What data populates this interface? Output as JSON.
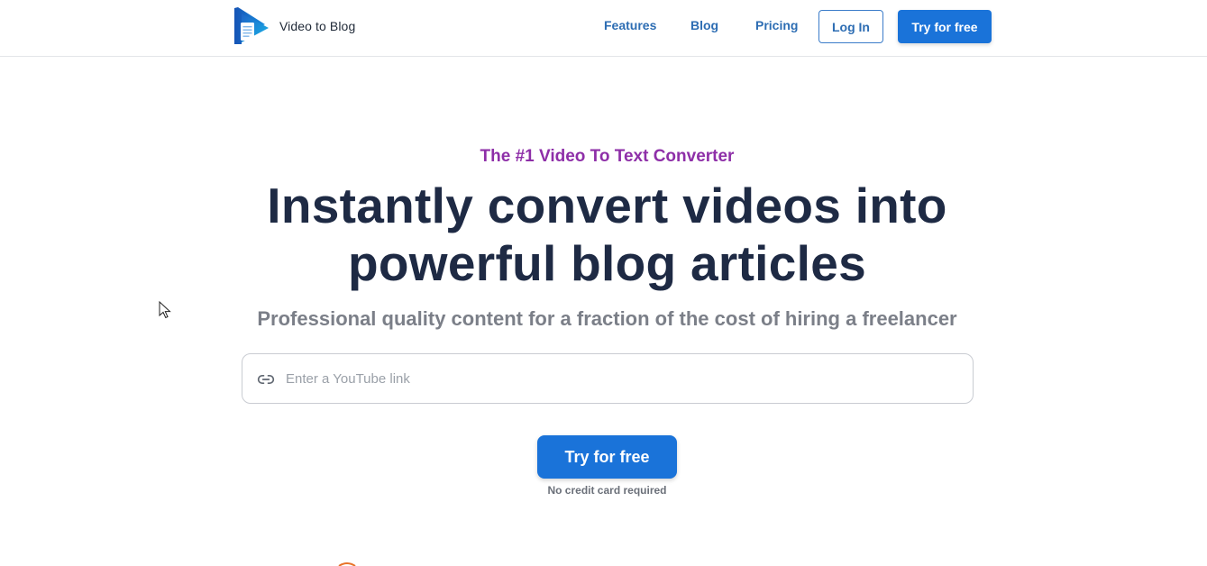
{
  "header": {
    "brand_name": "Video to Blog",
    "nav": {
      "features": "Features",
      "blog": "Blog",
      "pricing": "Pricing"
    },
    "login_label": "Log In",
    "cta_label": "Try for free"
  },
  "hero": {
    "eyebrow": "The #1 Video To Text Converter",
    "headline_line1": "Instantly convert videos into",
    "headline_line2": "powerful blog articles",
    "subhead": "Professional quality content for a fraction of the cost of hiring a freelancer",
    "input": {
      "placeholder": "Enter a YouTube link",
      "value": ""
    },
    "cta_label": "Try for free",
    "note": "No credit card required"
  },
  "colors": {
    "primary": "#1a73d9",
    "nav_link": "#2d6db3",
    "eyebrow": "#8e2fa8",
    "headline": "#1e2a44",
    "subhead": "#7b7f88"
  },
  "icons": {
    "logo": "play-document-logo",
    "input": "link-icon",
    "cursor": "mouse-pointer-icon"
  }
}
